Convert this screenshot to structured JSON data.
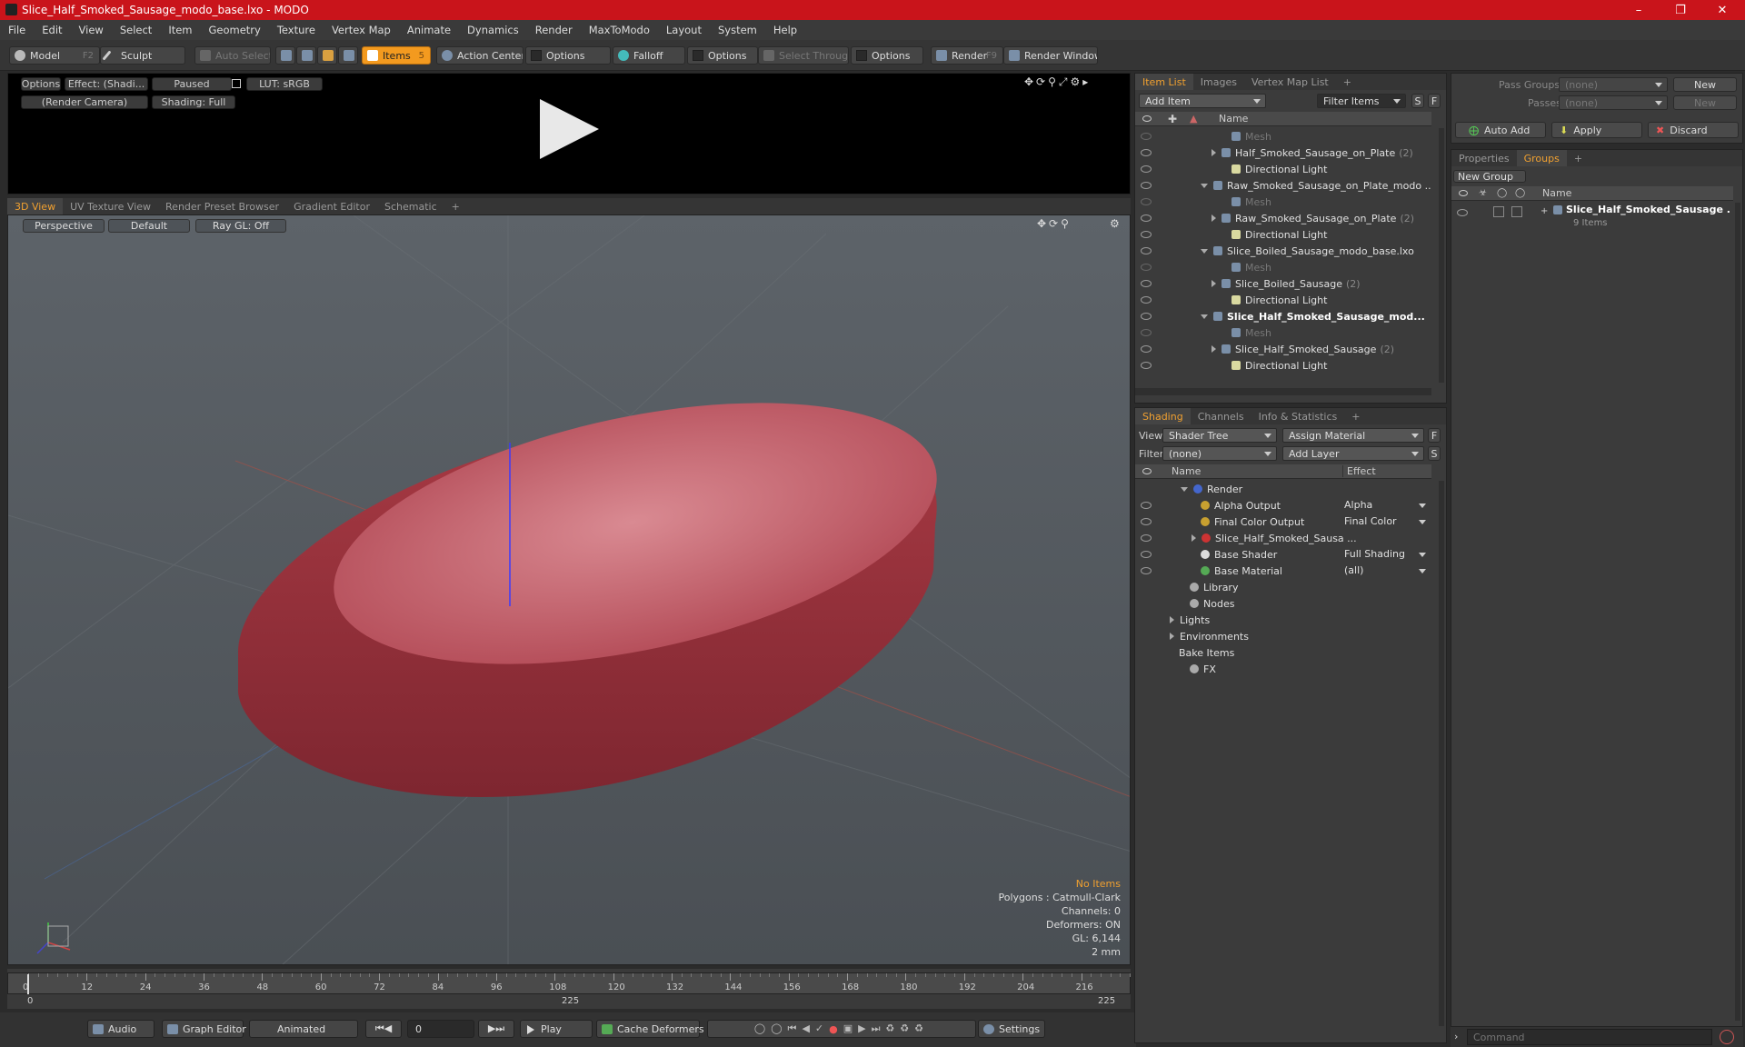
{
  "window": {
    "title": "Slice_Half_Smoked_Sausage_modo_base.lxo - MODO"
  },
  "menu": [
    "File",
    "Edit",
    "View",
    "Select",
    "Item",
    "Geometry",
    "Texture",
    "Vertex Map",
    "Animate",
    "Dynamics",
    "Render",
    "MaxToModo",
    "Layout",
    "System",
    "Help"
  ],
  "toolbar": {
    "model": "Model",
    "model_key": "F2",
    "sculpt": "Sculpt",
    "auto_select": "Auto Select",
    "items": "Items",
    "items_key": "5",
    "action_center": "Action Center",
    "options1": "Options",
    "falloff": "Falloff",
    "options2": "Options",
    "select_through": "Select Through",
    "options3": "Options",
    "render": "Render",
    "render_key": "F9",
    "render_window": "Render Window"
  },
  "preview": {
    "options": "Options",
    "effect": "Effect: (Shadi...",
    "paused": "Paused",
    "lut": "LUT: sRGB",
    "camera": "(Render Camera)",
    "shading": "Shading: Full"
  },
  "view_tabs": [
    "3D View",
    "UV Texture View",
    "Render Preset Browser",
    "Gradient Editor",
    "Schematic"
  ],
  "viewport": {
    "perspective": "Perspective",
    "default": "Default",
    "raygl": "Ray GL: Off",
    "no_items": "No Items",
    "polygons": "Polygons : Catmull-Clark",
    "channels": "Channels: 0",
    "deformers": "Deformers: ON",
    "gl": "GL: 6,144",
    "scale": "2 mm"
  },
  "timeline": {
    "ticks": [
      "0",
      "12",
      "24",
      "36",
      "48",
      "60",
      "72",
      "84",
      "96",
      "108",
      "120",
      "132",
      "144",
      "156",
      "168",
      "180",
      "192",
      "204",
      "216"
    ],
    "start": "0",
    "mid": "225",
    "end": "225"
  },
  "bottom": {
    "audio": "Audio",
    "graph_editor": "Graph Editor",
    "animated": "Animated",
    "frame": "0",
    "play": "Play",
    "cache_deformers": "Cache Deformers",
    "settings": "Settings"
  },
  "itemlist": {
    "tabs": [
      "Item List",
      "Images",
      "Vertex Map List"
    ],
    "add_item": "Add Item",
    "filter": "Filter Items",
    "s": "S",
    "f": "F",
    "name_col": "Name",
    "rows": [
      {
        "label": "Mesh",
        "indent": 3,
        "ghost": true,
        "tri": ""
      },
      {
        "label": "Half_Smoked_Sausage_on_Plate",
        "count": "(2)",
        "indent": 2,
        "tri": "r"
      },
      {
        "label": "Directional Light",
        "indent": 3,
        "tri": ""
      },
      {
        "label": "Raw_Smoked_Sausage_on_Plate_modo ...",
        "indent": 1,
        "tri": "d"
      },
      {
        "label": "Mesh",
        "indent": 3,
        "ghost": true,
        "tri": ""
      },
      {
        "label": "Raw_Smoked_Sausage_on_Plate",
        "count": "(2)",
        "indent": 2,
        "tri": "r"
      },
      {
        "label": "Directional Light",
        "indent": 3,
        "tri": ""
      },
      {
        "label": "Slice_Boiled_Sausage_modo_base.lxo",
        "indent": 1,
        "tri": "d"
      },
      {
        "label": "Mesh",
        "indent": 3,
        "ghost": true,
        "tri": ""
      },
      {
        "label": "Slice_Boiled_Sausage",
        "count": "(2)",
        "indent": 2,
        "tri": "r"
      },
      {
        "label": "Directional Light",
        "indent": 3,
        "tri": ""
      },
      {
        "label": "Slice_Half_Smoked_Sausage_mod...",
        "indent": 1,
        "tri": "d",
        "bold": true
      },
      {
        "label": "Mesh",
        "indent": 3,
        "ghost": true,
        "tri": ""
      },
      {
        "label": "Slice_Half_Smoked_Sausage",
        "count": "(2)",
        "indent": 2,
        "tri": "r"
      },
      {
        "label": "Directional Light",
        "indent": 3,
        "tri": ""
      }
    ]
  },
  "shading": {
    "tabs": [
      "Shading",
      "Channels",
      "Info & Statistics"
    ],
    "view_label": "View",
    "view_value": "Shader Tree",
    "assign": "Assign Material",
    "filter_label": "Filter",
    "filter_value": "(none)",
    "add_layer": "Add Layer",
    "f": "F",
    "s": "S",
    "name_col": "Name",
    "effect_col": "Effect",
    "rows": [
      {
        "label": "Render",
        "effect": "",
        "indent": 0,
        "tri": "d",
        "eye": false,
        "color": "#4466cc"
      },
      {
        "label": "Alpha Output",
        "effect": "Alpha",
        "indent": 1,
        "tri": "",
        "eye": true,
        "color": "#c8a030"
      },
      {
        "label": "Final Color Output",
        "effect": "Final Color",
        "indent": 1,
        "tri": "",
        "eye": true,
        "color": "#c8a030"
      },
      {
        "label": "Slice_Half_Smoked_Sausa ...",
        "effect": "",
        "indent": 1,
        "tri": "r",
        "eye": true,
        "color": "#cc3333"
      },
      {
        "label": "Base Shader",
        "effect": "Full Shading",
        "indent": 1,
        "tri": "",
        "eye": true,
        "color": "#dddddd"
      },
      {
        "label": "Base Material",
        "effect": "(all)",
        "indent": 1,
        "tri": "",
        "eye": true,
        "color": "#55aa55"
      },
      {
        "label": "Library",
        "effect": "",
        "indent": 0,
        "tri": "",
        "eye": false,
        "color": "#aaaaaa"
      },
      {
        "label": "Nodes",
        "effect": "",
        "indent": 0,
        "tri": "",
        "eye": false,
        "color": "#aaaaaa"
      },
      {
        "label": "Lights",
        "effect": "",
        "indent": -1,
        "tri": "r",
        "eye": false,
        "color": ""
      },
      {
        "label": "Environments",
        "effect": "",
        "indent": -1,
        "tri": "r",
        "eye": false,
        "color": ""
      },
      {
        "label": "Bake Items",
        "effect": "",
        "indent": -1,
        "tri": "",
        "eye": false,
        "color": ""
      },
      {
        "label": "FX",
        "effect": "",
        "indent": 0,
        "tri": "",
        "eye": false,
        "color": "#aaaaaa"
      }
    ]
  },
  "passes": {
    "pass_groups": "Pass Groups",
    "passes": "Passes",
    "none1": "(none)",
    "none2": "(none)",
    "new1": "New",
    "new2": "New",
    "auto_add": "Auto Add",
    "apply": "Apply",
    "discard": "Discard"
  },
  "groups": {
    "tabs": [
      "Properties",
      "Groups"
    ],
    "new_group": "New Group",
    "name_col": "Name",
    "item": "Slice_Half_Smoked_Sausage ...",
    "count": "9 Items"
  },
  "command": {
    "placeholder": "Command"
  }
}
